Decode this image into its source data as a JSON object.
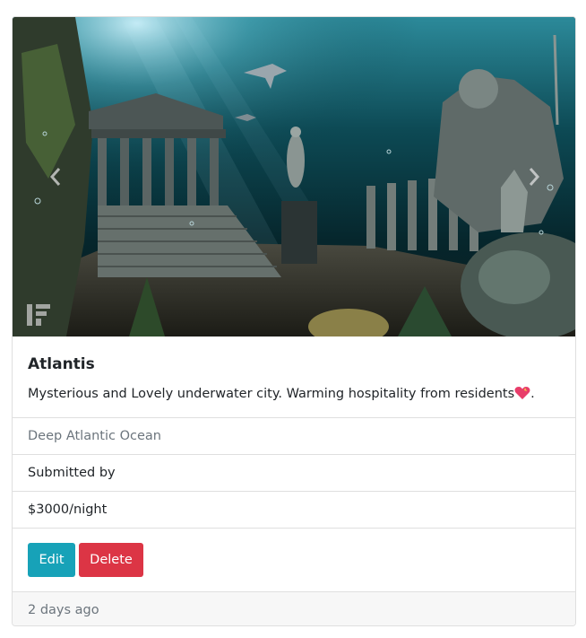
{
  "card": {
    "title": "Atlantis",
    "description": "Mysterious and Lovely underwater city. Warming hospitality from residents",
    "description_suffix": ".",
    "location": "Deep Atlantic Ocean",
    "submitted_by": "Submitted by",
    "price": "$3000/night",
    "edit_label": "Edit",
    "delete_label": "Delete",
    "timestamp": "2 days ago"
  },
  "carousel": {
    "prev_icon": "chevron-left-icon",
    "next_icon": "chevron-right-icon",
    "image_subject": "underwater ruins of Atlantis with temple, statues, columns and sharks"
  },
  "colors": {
    "edit": "#17a2b8",
    "delete": "#dc3545",
    "border": "#dfdfdf",
    "muted_text": "#6c757d",
    "footer_bg": "#f7f7f7"
  }
}
